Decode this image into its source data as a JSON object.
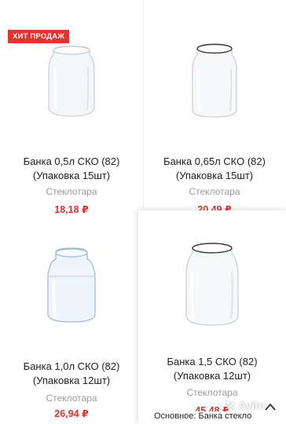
{
  "badge": "ХИТ ПРОДАЖ",
  "products": [
    {
      "title_line1": "Банка 0,5л СКО (82)",
      "title_line2": "(Упаковка 15шт)",
      "vendor": "Стеклотара",
      "price": "18,18 ₽"
    },
    {
      "title_line1": "Банка 0,65л СКО (82)",
      "title_line2": "(Упаковка 15шт)",
      "vendor": "Стеклотара",
      "price": "20,49 ₽"
    },
    {
      "title_line1": "Банка 1,0л СКО (82)",
      "title_line2": "(Упаковка 12шт)",
      "vendor": "Стеклотара",
      "price": "26,94 ₽"
    },
    {
      "title_line1": "Банка 1,5 СКО (82)",
      "title_line2": "(Упаковка 12шт)",
      "vendor": "Стеклотара",
      "price": "45,48 ₽"
    }
  ],
  "tooltip": "Основное: Банка стекло",
  "watermark": "Avito"
}
